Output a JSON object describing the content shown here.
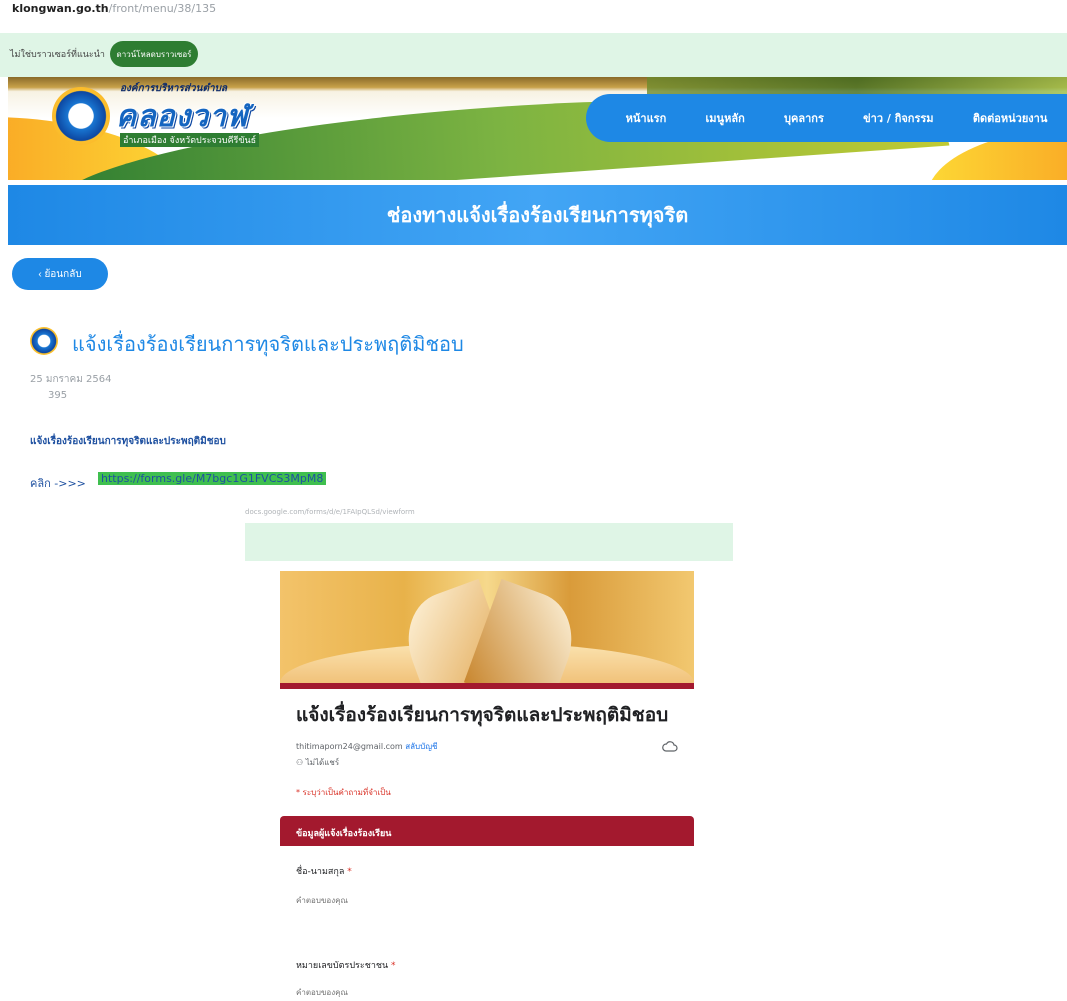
{
  "browser": {
    "domain": "klongwan.go.th",
    "path": "/front/menu/38/135"
  },
  "notice": {
    "text": "ไม่ใช่บราวเซอร์ที่แนะนำ",
    "button": "ดาวน์โหลดบราวเซอร์"
  },
  "header": {
    "org_top": "องค์การบริหารส่วนตำบล",
    "org_name": "คลองวาฬ",
    "org_sub": "อำเภอเมือง จังหวัดประจวบคีรีขันธ์",
    "nav": [
      "หน้าแรก",
      "เมนูหลัก",
      "บุคลากร",
      "ข่าว / กิจกรรม",
      "ติดต่อหน่วยงาน"
    ]
  },
  "page_title": "ช่องทางแจ้งเรื่องร้องเรียนการทุจริต",
  "back_button": "ย้อนกลับ",
  "post": {
    "title": "แจ้งเรื่องร้องเรียนการทุจริตและประพฤติมิชอบ",
    "date": "25 มกราคม 2564",
    "views": "395",
    "body": "แจ้งเรื่องร้องเรียนการทุจริตและประพฤติมิชอบ",
    "link_label": "คลิก ->>>",
    "link_url": "https://forms.gle/M7bgc1G1FVCS3MpM8"
  },
  "embedded_form": {
    "url": "docs.google.com/forms/d/e/1FAIpQLSd/viewform",
    "title": "แจ้งเรื่องร้องเรียนการทุจริตและประพฤติมิชอบ",
    "account": "thitimaporn24@gmail.com",
    "switch_account": "สลับบัญชี",
    "share_note": "ไม่ได้แชร์",
    "required_note": "* ระบุว่าเป็นคำถามที่จำเป็น",
    "section_title": "ข้อมูลผู้แจ้งเรื่องร้องเรียน",
    "questions": [
      {
        "label": "ชื่อ-นามสกุล",
        "placeholder": "คำตอบของคุณ"
      },
      {
        "label": "หมายเลขบัตรประชาชน",
        "placeholder": "คำตอบของคุณ"
      }
    ],
    "required_mark": "*"
  },
  "colors": {
    "nav_blue": "#1e88e5",
    "form_accent": "#a3192e",
    "notice_green": "#2e7d32",
    "link_highlight": "#3fbf4f"
  }
}
